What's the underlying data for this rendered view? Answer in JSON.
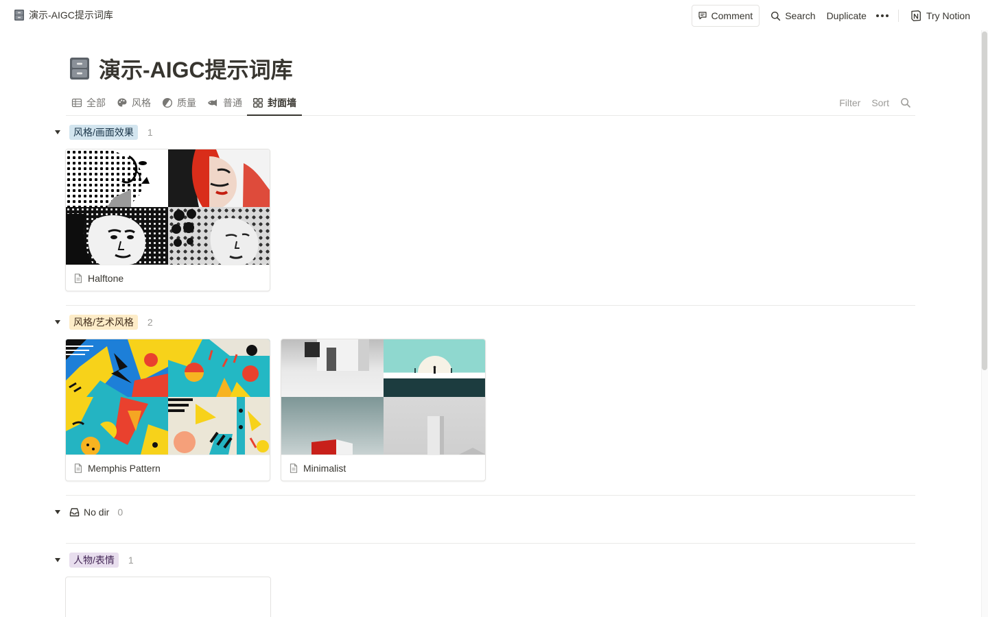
{
  "page": {
    "breadcrumb": "演示-AIGC提示词库",
    "title": "演示-AIGC提示词库"
  },
  "topbar": {
    "comment": "Comment",
    "search": "Search",
    "duplicate": "Duplicate",
    "try_notion": "Try Notion"
  },
  "tabs": [
    {
      "label": "全部",
      "icon": "table-icon"
    },
    {
      "label": "风格",
      "icon": "palette-icon"
    },
    {
      "label": "质量",
      "icon": "half-circle-icon"
    },
    {
      "label": "普通",
      "icon": "fish-icon"
    },
    {
      "label": "封面墙",
      "icon": "gallery-icon",
      "active": true
    }
  ],
  "view_tools": {
    "filter": "Filter",
    "sort": "Sort"
  },
  "groups": [
    {
      "tag": "风格/画面效果",
      "tag_bg": "#d3e5ef",
      "tag_color": "#183347",
      "count": "1",
      "cards": [
        {
          "title": "Halftone"
        }
      ]
    },
    {
      "tag": "风格/艺术风格",
      "tag_bg": "#fdecc8",
      "tag_color": "#402c1b",
      "count": "2",
      "cards": [
        {
          "title": "Memphis Pattern"
        },
        {
          "title": "Minimalist"
        }
      ]
    },
    {
      "tag": "No dir",
      "count": "0",
      "icon": "inbox-icon"
    },
    {
      "tag": "人物/表情",
      "tag_bg": "#e8deee",
      "tag_color": "#412454",
      "count": "1"
    }
  ]
}
